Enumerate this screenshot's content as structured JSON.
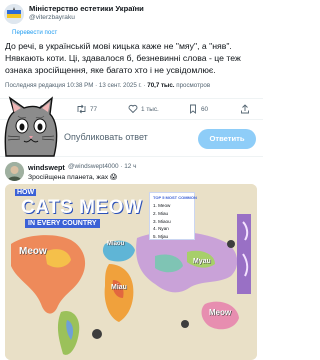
{
  "post": {
    "author_name": "Міністерство естетики України",
    "author_handle": "@viterzbayraku",
    "translate_label": "Перевести пост",
    "text": "До речі, в  українській мові кицька каже не \"мяу\", а \"няв\". Нявкають коти. Ці, здавалося б, безневинні слова - це теж ознака зросійщення, яке багато хто і не усвідомлює.",
    "meta_prefix": "Последняя редакция 10:38 PM · 13 сент. 2025 г. · ",
    "views_count": "70,7 тыс.",
    "views_label": " просмотров"
  },
  "actions": {
    "reply_count": "",
    "retweet_count": "77",
    "like_count": "1 тыс.",
    "bookmark_count": "60"
  },
  "reply_box": {
    "placeholder": "Опубликовать ответ",
    "button_label": "Ответить"
  },
  "reply": {
    "name": "windswept",
    "handle": "@windswept4000 · 12 ч",
    "text": "Зросійщена планета, жах 😱"
  },
  "map_image": {
    "title_how": "HOW",
    "title_main": "CATS MEOW",
    "title_sub": "IN EVERY COUNTRY",
    "top5_title": "TOP 5 MOST COMMON",
    "top5": [
      "1. Meow",
      "2. Miau",
      "3. Miaou",
      "4. Nyan",
      "5. Mjau"
    ],
    "labels": [
      "Meow",
      "Miaou",
      "Myau",
      "Miau",
      "Meow"
    ]
  },
  "colors": {
    "accent": "#1d9bf0",
    "reply_button": "#8ecdf8",
    "map_ocean": "#e9e0c7",
    "map_title": "#3b61d6"
  },
  "icons": [
    "avatar-flag",
    "reply-icon",
    "retweet-icon",
    "like-icon",
    "bookmark-icon",
    "share-icon",
    "cat-meme",
    "avatar-photo"
  ]
}
